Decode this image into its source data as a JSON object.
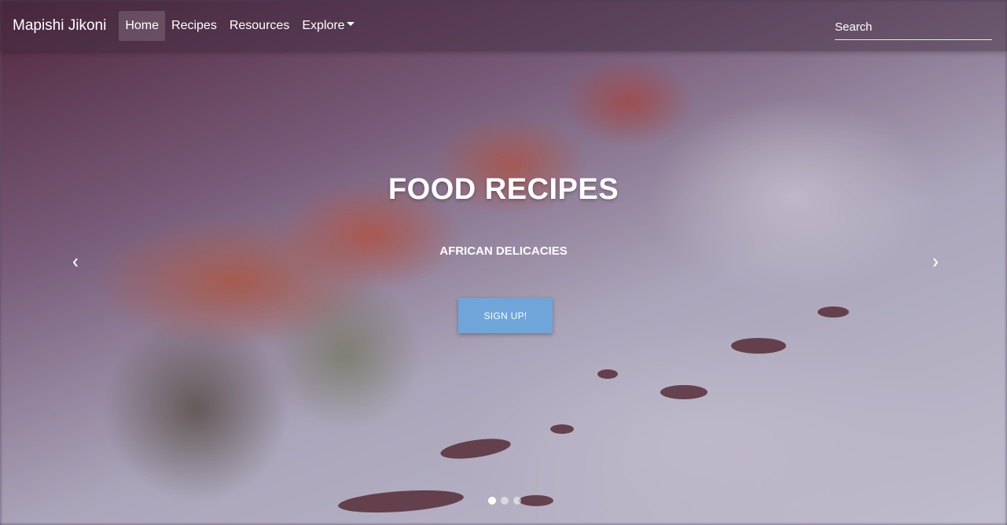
{
  "navbar": {
    "brand": "Mapishi Jikoni",
    "links": [
      {
        "label": "Home",
        "active": true
      },
      {
        "label": "Recipes"
      },
      {
        "label": "Resources"
      },
      {
        "label": "Explore",
        "dropdown": true
      }
    ],
    "search_placeholder": "Search"
  },
  "hero": {
    "title": "FOOD RECIPES",
    "subtitle": "AFRICAN DELICACIES",
    "button_label": "SIGN UP!",
    "prev_icon": "chevron-left-icon",
    "next_icon": "chevron-right-icon",
    "slide_count": 3,
    "active_slide": 1
  },
  "colors": {
    "button": "#6fa5d8",
    "text": "#ffffff"
  }
}
